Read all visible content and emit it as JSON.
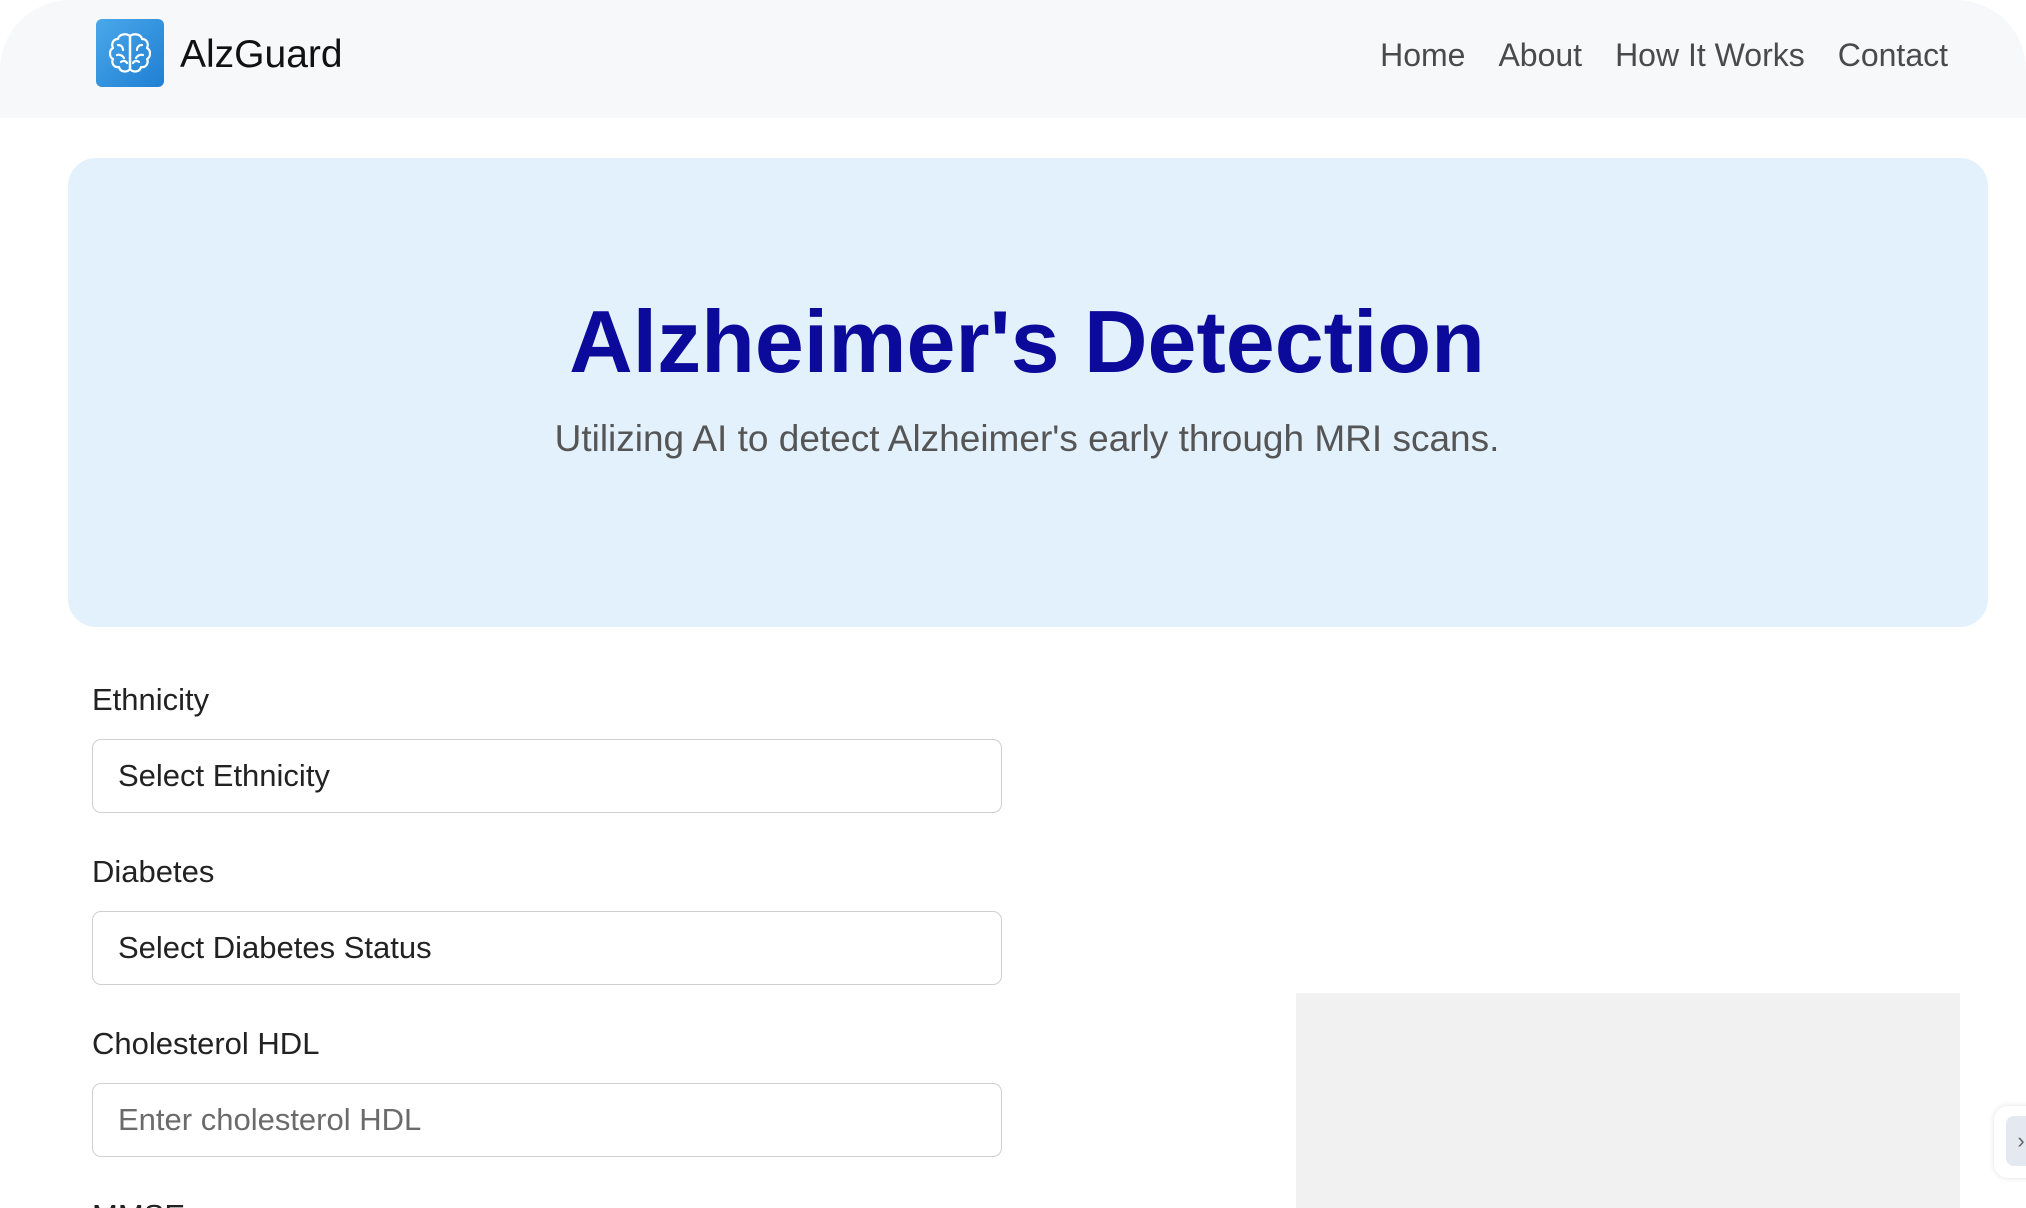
{
  "brand": {
    "name": "AlzGuard",
    "icon": "brain-icon",
    "color": "#2b8de0"
  },
  "nav": {
    "items": [
      "Home",
      "About",
      "How It Works",
      "Contact"
    ]
  },
  "hero": {
    "title": "Alzheimer's Detection",
    "subtitle": "Utilizing AI to detect Alzheimer's early through MRI scans.",
    "background": "#e3f1fc",
    "title_color": "#0b0a9b"
  },
  "form": {
    "ethnicity": {
      "label": "Ethnicity",
      "value": "Select Ethnicity"
    },
    "diabetes": {
      "label": "Diabetes",
      "value": "Select Diabetes Status"
    },
    "cholesterol_hdl": {
      "label": "Cholesterol HDL",
      "placeholder": "Enter cholesterol HDL"
    },
    "mmse": {
      "label": "MMSE"
    }
  },
  "side_tab": {
    "icon": "chevron-right-icon"
  }
}
